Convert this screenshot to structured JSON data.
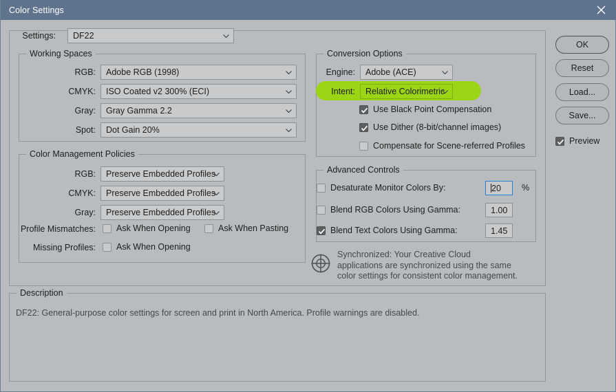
{
  "window": {
    "title": "Color Settings",
    "close_label": "×",
    "titlebar_color": "#5f748c",
    "background_color": "#b9bcbe"
  },
  "settings_row": {
    "label": "Settings:",
    "value": "DF22"
  },
  "working_spaces": {
    "legend": "Working Spaces",
    "rows": [
      {
        "label": "RGB:",
        "value": "Adobe RGB (1998)"
      },
      {
        "label": "CMYK:",
        "value": "ISO Coated v2 300% (ECI)"
      },
      {
        "label": "Gray:",
        "value": "Gray Gamma 2.2"
      },
      {
        "label": "Spot:",
        "value": "Dot Gain 20%"
      }
    ]
  },
  "color_management_policies": {
    "legend": "Color Management Policies",
    "rows": [
      {
        "label": "RGB:",
        "value": "Preserve Embedded Profiles"
      },
      {
        "label": "CMYK:",
        "value": "Preserve Embedded Profiles"
      },
      {
        "label": "Gray:",
        "value": "Preserve Embedded Profiles"
      }
    ],
    "profile_mismatches_label": "Profile Mismatches:",
    "missing_profiles_label": "Missing Profiles:",
    "checkboxes": {
      "mismatch_opening": {
        "label": "Ask When Opening",
        "checked": false
      },
      "mismatch_pasting": {
        "label": "Ask When Pasting",
        "checked": false
      },
      "missing_opening": {
        "label": "Ask When Opening",
        "checked": false
      }
    }
  },
  "conversion_options": {
    "legend": "Conversion Options",
    "engine_label": "Engine:",
    "engine_value": "Adobe (ACE)",
    "intent_label": "Intent:",
    "intent_value": "Relative Colorimetric",
    "intent_highlight_color": "#9cd416",
    "checkboxes": [
      {
        "label": "Use Black Point Compensation",
        "checked": true
      },
      {
        "label": "Use Dither (8-bit/channel images)",
        "checked": true
      },
      {
        "label": "Compensate for Scene-referred Profiles",
        "checked": false
      }
    ]
  },
  "advanced_controls": {
    "legend": "Advanced Controls",
    "rows": [
      {
        "label": "Desaturate Monitor Colors By:",
        "checked": false,
        "value": "20",
        "suffix": "%",
        "focused": true
      },
      {
        "label": "Blend RGB Colors Using Gamma:",
        "checked": false,
        "value": "1.00",
        "suffix": "",
        "focused": false
      },
      {
        "label": "Blend Text Colors Using Gamma:",
        "checked": true,
        "value": "1.45",
        "suffix": "",
        "focused": false
      }
    ]
  },
  "sync_note": {
    "icon": "sync-target-icon",
    "text": "Synchronized: Your Creative Cloud applications are synchronized using the same color settings for consistent color management."
  },
  "description": {
    "legend": "Description",
    "text": "DF22:  General-purpose color settings for screen and print in North America. Profile warnings are disabled."
  },
  "buttons": {
    "ok": "OK",
    "reset": "Reset",
    "load": "Load...",
    "save": "Save...",
    "preview": {
      "label": "Preview",
      "checked": true
    }
  }
}
